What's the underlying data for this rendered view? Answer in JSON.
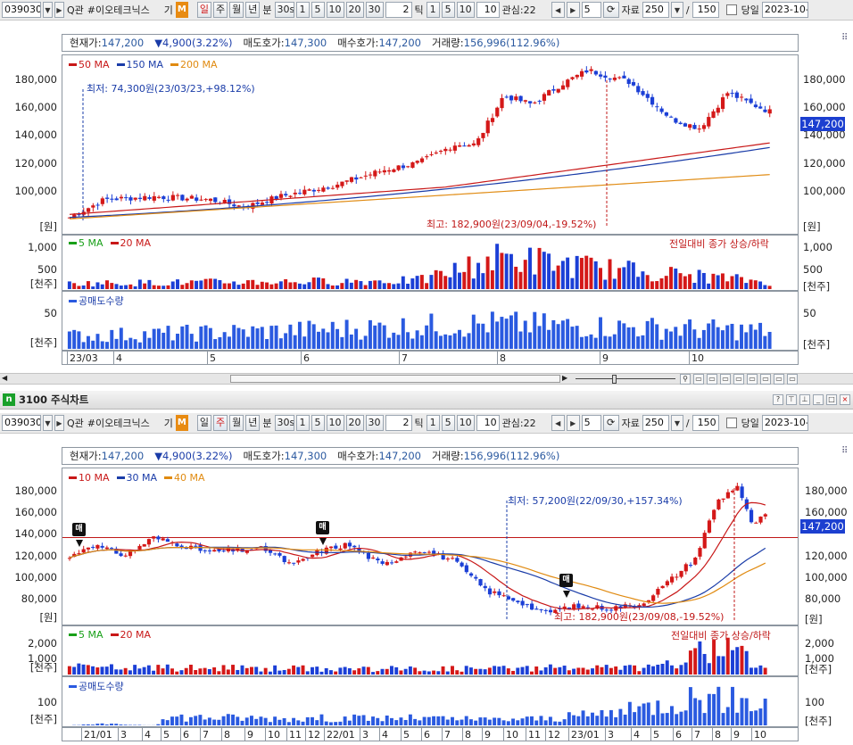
{
  "toolbar_top": {
    "code": "039030",
    "search_label": "Q관",
    "stock_name": "#이오테크닉스",
    "gi_label": "기",
    "m_label": "M",
    "periods": [
      "일",
      "주",
      "월",
      "년"
    ],
    "bun_label": "분",
    "min_sel": "30s",
    "mins": [
      "1",
      "5",
      "10",
      "20",
      "30"
    ],
    "tick_value": "2",
    "tick_label": "틱",
    "ticks": [
      "1",
      "5",
      "10"
    ],
    "tick_custom": "10",
    "interest": "관심:22",
    "page_num": "5",
    "data_label": "자료",
    "data_count": "250",
    "slash": "/",
    "view_count": "150",
    "today_label": "당일",
    "date": "2023-10-"
  },
  "chart1": {
    "info": {
      "cur_k": "현재가:",
      "cur_v": "147,200",
      "chg": "▼4,900(3.22%)",
      "ask_k": "매도호가:",
      "ask_v": "147,300",
      "bid_k": "매수호가:",
      "bid_v": "147,200",
      "vol_k": "거래량:",
      "vol_v": "156,996(112.96%)"
    },
    "legend": [
      {
        "name": "50 MA",
        "color": "#c81818"
      },
      {
        "name": "150 MA",
        "color": "#1a3ca8"
      },
      {
        "name": "200 MA",
        "color": "#e08a10"
      }
    ],
    "yticks": [
      "180,000",
      "160,000",
      "140,000",
      "120,000",
      "100,000"
    ],
    "unit": "[원]",
    "price_tag": "147,200",
    "low_note": "최저: 74,300원(23/03/23,+98.12%)",
    "high_note": "최고: 182,900원(23/09/04,-19.52%)",
    "vol_legend": [
      {
        "name": "5 MA",
        "color": "#18a018"
      },
      {
        "name": "20 MA",
        "color": "#c81818"
      }
    ],
    "vol_caption": "전일대비 종가 상승/하락",
    "vol_yticks": [
      "1,000",
      "500"
    ],
    "vol_unit": "[천주]",
    "short_legend": "공매도수량",
    "short_yticks": [
      "50"
    ],
    "short_unit": "[천주]",
    "xlabels": [
      "23/03",
      "4",
      "5",
      "6",
      "7",
      "8",
      "9",
      "10"
    ]
  },
  "window2": {
    "title": "3100 주식차트",
    "icon": "n"
  },
  "toolbar_bottom": {
    "code": "039030",
    "search_label": "Q관",
    "stock_name": "#이오테크닉스",
    "gi_label": "기",
    "m_label": "M",
    "periods": [
      "일",
      "주",
      "월",
      "년"
    ],
    "bun_label": "분",
    "min_sel": "30s",
    "mins": [
      "1",
      "5",
      "10",
      "20",
      "30"
    ],
    "tick_value": "2",
    "tick_label": "틱",
    "ticks": [
      "1",
      "5",
      "10"
    ],
    "tick_custom": "10",
    "interest": "관심:22",
    "page_num": "5",
    "data_label": "자료",
    "data_count": "250",
    "slash": "/",
    "view_count": "150",
    "today_label": "당일",
    "date": "2023-10-"
  },
  "chart2": {
    "info": {
      "cur_k": "현재가:",
      "cur_v": "147,200",
      "chg": "▼4,900(3.22%)",
      "ask_k": "매도호가:",
      "ask_v": "147,300",
      "bid_k": "매수호가:",
      "bid_v": "147,200",
      "vol_k": "거래량:",
      "vol_v": "156,996(112.96%)"
    },
    "legend": [
      {
        "name": "10 MA",
        "color": "#c81818"
      },
      {
        "name": "30 MA",
        "color": "#1a3ca8"
      },
      {
        "name": "40 MA",
        "color": "#e08a10"
      }
    ],
    "yticks": [
      "180,000",
      "160,000",
      "140,000",
      "120,000",
      "100,000",
      "80,000"
    ],
    "unit": "[원]",
    "price_tag": "147,200",
    "low_note": "최저: 57,200원(22/09/30,+157.34%)",
    "high_note": "최고: 182,900원(23/09/08,-19.52%)",
    "sell_badge": "매",
    "vol_legend": [
      {
        "name": "5 MA",
        "color": "#18a018"
      },
      {
        "name": "20 MA",
        "color": "#c81818"
      }
    ],
    "vol_caption": "전일대비 종가 상승/하락",
    "vol_yticks": [
      "2,000",
      "1,000"
    ],
    "vol_unit": "[천주]",
    "short_legend": "공매도수량",
    "short_yticks": [
      "100"
    ],
    "short_unit": "[천주]",
    "xlabels": [
      "21/01",
      "3",
      "4",
      "5",
      "6",
      "7",
      "8",
      "9",
      "10",
      "11",
      "12",
      "22/01",
      "3",
      "4",
      "5",
      "6",
      "7",
      "8",
      "9",
      "10",
      "11",
      "12",
      "23/01",
      "3",
      "4",
      "5",
      "6",
      "7",
      "8",
      "9",
      "10"
    ]
  }
}
